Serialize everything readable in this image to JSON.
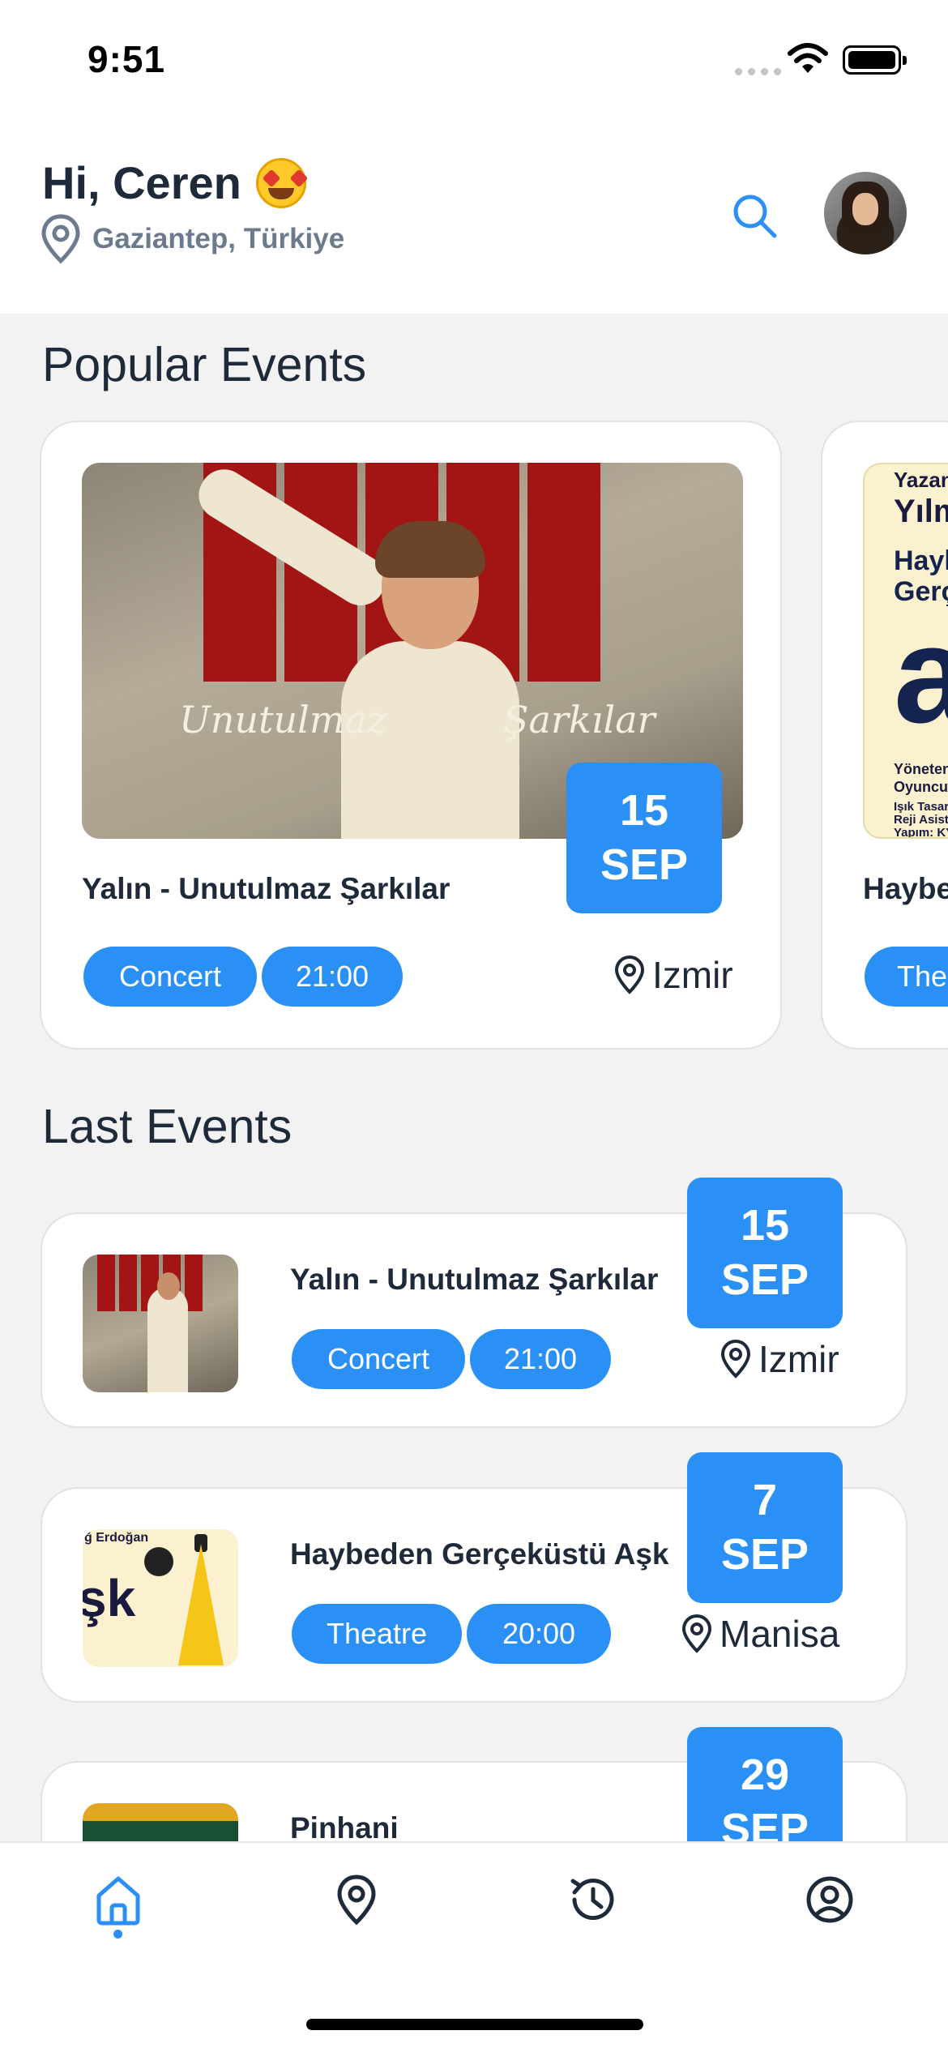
{
  "status_bar": {
    "time": "9:51"
  },
  "header": {
    "greeting": "Hi, Ceren",
    "emoji_icon": "star-struck-emoji",
    "location": "Gaziantep, Türkiye"
  },
  "popular": {
    "title": "Popular Events",
    "cards": [
      {
        "poster_script_left": "Unutulmaz",
        "poster_script_right": "Şarkılar",
        "day": "15",
        "month": "SEP",
        "title": "Yalın - Unutulmaz Şarkılar",
        "category": "Concert",
        "time": "21:00",
        "place": "Izmir"
      },
      {
        "poster_lines": [
          "Yazan:",
          "Yılm",
          "Hayl",
          "Gerç",
          "a",
          "Yöneten",
          "Oyuncul",
          "Işık Tasar",
          "Reji Asist",
          "Yapım: KY"
        ],
        "title": "Haybe",
        "category": "The"
      }
    ]
  },
  "last": {
    "title": "Last Events",
    "items": [
      {
        "title": "Yalın - Unutulmaz Şarkılar",
        "category": "Concert",
        "time": "21:00",
        "place": "Izmir",
        "day": "15",
        "month": "SEP"
      },
      {
        "title": "Haybeden Gerçeküstü Aşk",
        "category": "Theatre",
        "time": "20:00",
        "place": "Manisa",
        "day": "7",
        "month": "SEP",
        "thumb_text": "şk",
        "thumb_top_text": "ğ Erdoğan"
      },
      {
        "title": "Pinhani",
        "day": "29",
        "month": "SEP"
      }
    ]
  },
  "tabs": [
    {
      "name": "home",
      "icon": "home-icon",
      "active": true
    },
    {
      "name": "map",
      "icon": "map-pin-icon",
      "active": false
    },
    {
      "name": "history",
      "icon": "history-icon",
      "active": false
    },
    {
      "name": "profile",
      "icon": "profile-icon",
      "active": false
    }
  ],
  "colors": {
    "accent": "#2a90f5",
    "text": "#1e2a3a",
    "muted": "#6b7a8c",
    "background": "#f2f2f2"
  }
}
